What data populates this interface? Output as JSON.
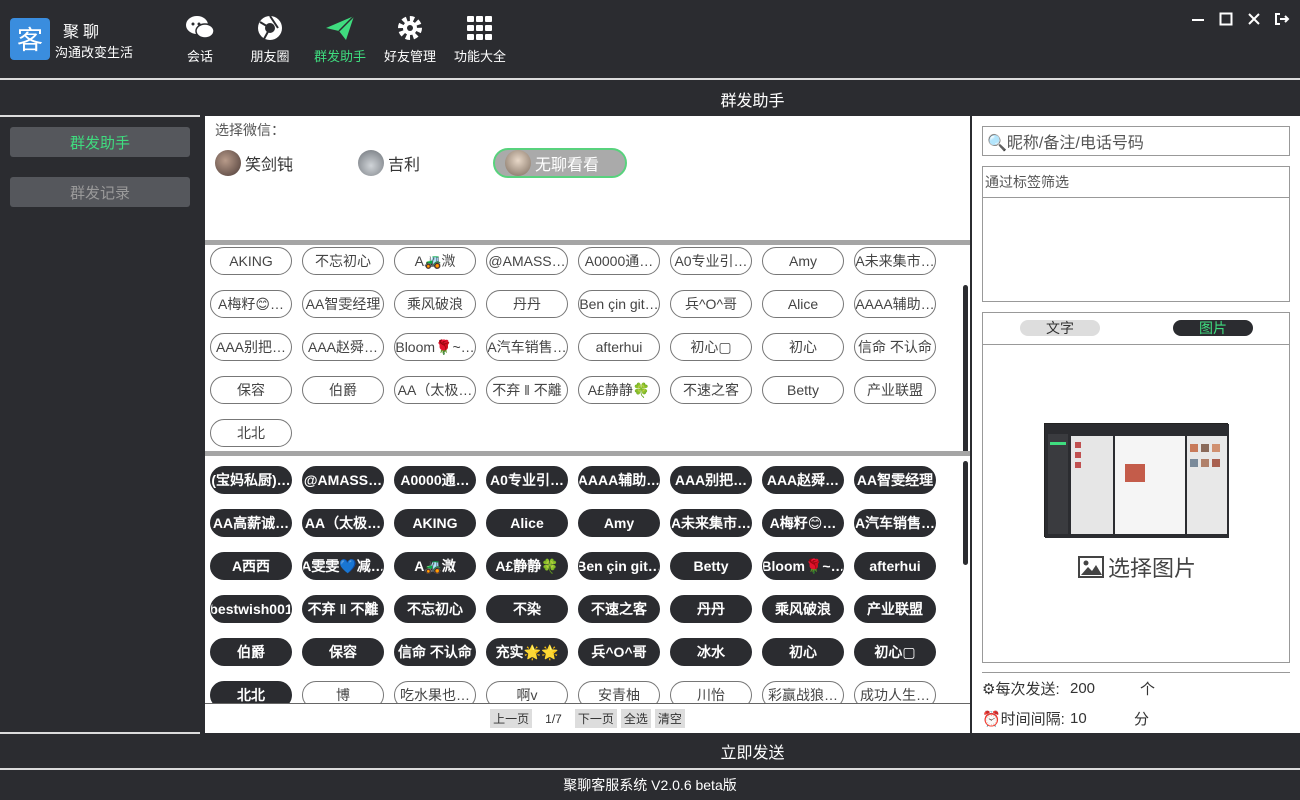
{
  "app": {
    "logo_name": "聚聊",
    "slogan": "沟通改变生活"
  },
  "nav": [
    {
      "label": "会话",
      "icon": "chat-icon"
    },
    {
      "label": "朋友圈",
      "icon": "moments-icon"
    },
    {
      "label": "群发助手",
      "icon": "send-icon",
      "active": true
    },
    {
      "label": "好友管理",
      "icon": "gear-icon"
    },
    {
      "label": "功能大全",
      "icon": "grid-icon"
    }
  ],
  "sidebar": {
    "items": [
      "群发助手",
      "群发记录"
    ]
  },
  "main": {
    "title": "群发助手",
    "select_label": "选择微信：",
    "accounts": [
      "笑剑钝",
      "吉利",
      "无聊看看"
    ]
  },
  "top_chips": [
    "AKING",
    "不忘初心",
    "A🚜溦",
    "@AMASS…",
    "A0000通…",
    "A0专业引…",
    "Amy",
    "A未来集市…",
    "A梅籽😊…",
    "AA智雯经理",
    "乘风破浪",
    "丹丹",
    "Ben çin git…",
    "兵^O^哥",
    "Alice",
    "AAAA辅助…",
    "AAA别把…",
    "AAA赵舜…",
    "Bloom🌹~…",
    "A汽车销售…",
    "afterhui",
    "初心▢",
    "初心",
    "信命 不认命",
    "保容",
    "伯爵",
    "AA（太极…",
    "不弃 ‖ 不離",
    "A£静静🍀",
    "不速之客",
    "Betty",
    "产业联盟",
    "北北"
  ],
  "bottom_chips": [
    "(宝妈私厨)…",
    "@AMASS…",
    "A0000通…",
    "A0专业引…",
    "AAAA辅助…",
    "AAA别把…",
    "AAA赵舜…",
    "AA智雯经理",
    "AA高薪诚…",
    "AA（太极…",
    "AKING",
    "Alice",
    "Amy",
    "A未来集市…",
    "A梅籽😊…",
    "A汽车销售…",
    "A西西",
    "A雯雯💙减…",
    "A🚜溦",
    "A£静静🍀",
    "Ben çin git…",
    "Betty",
    "Bloom🌹~…",
    "afterhui",
    "bestwish001",
    "不弃 ‖ 不離",
    "不忘初心",
    "不染",
    "不速之客",
    "丹丹",
    "乘风破浪",
    "产业联盟",
    "伯爵",
    "保容",
    "信命 不认命",
    "充实🌟🌟",
    "兵^O^哥",
    "冰水",
    "初心",
    "初心▢",
    "北北",
    "博",
    "吃水果也…",
    "啊v",
    "安青柚",
    "川怡",
    "彩赢战狼…",
    "成功人生…"
  ],
  "pager": {
    "prev": "上一页",
    "page": "1/7",
    "next": "下一页",
    "select_all": "全选",
    "clear": "清空"
  },
  "right": {
    "search_placeholder": "🔍昵称/备注/电话号码",
    "tag_filter": "通过标签筛选",
    "tab_text": "文字",
    "tab_image": "图片",
    "choose_image": "选择图片",
    "per_send_label": "⚙每次发送:",
    "per_send_value": "200",
    "per_send_unit": "个",
    "interval_label": "⏰时间间隔:",
    "interval_value": "10",
    "interval_unit": "分"
  },
  "send_button": "立即发送",
  "footer": "聚聊客服系统 V2.0.6 beta版"
}
